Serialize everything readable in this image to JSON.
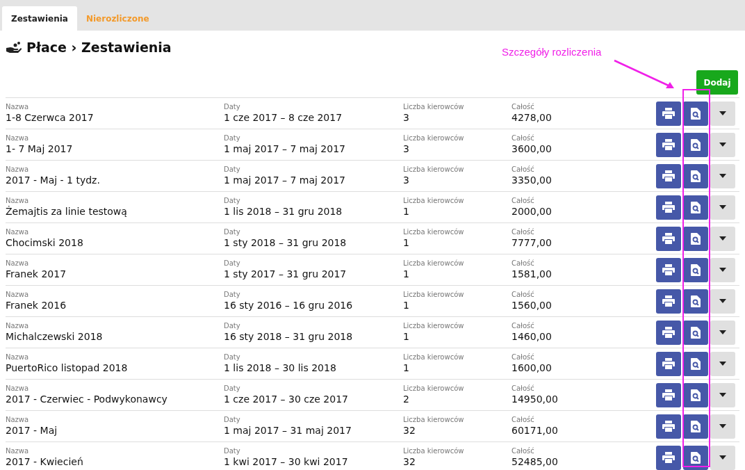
{
  "tabs": [
    {
      "label": "Zestawienia",
      "selected": true
    },
    {
      "label": "Nierozliczone",
      "selected": false
    }
  ],
  "breadcrumb": "Płace › Zestawienia",
  "annotation": "Szczegóły rozliczenia",
  "add_button": "Dodaj",
  "rows": [
    {
      "cells": [
        {
          "label": "Nazwa",
          "value": "1-8 Czerwca 2017"
        },
        {
          "label": "Daty",
          "value": "1 cze 2017 – 8 cze 2017"
        },
        {
          "label": "Liczba kierowców",
          "value": "3"
        },
        {
          "label": "Całość",
          "value": "4278,00"
        }
      ]
    },
    {
      "cells": [
        {
          "label": "Nazwa",
          "value": "1- 7 Maj 2017"
        },
        {
          "label": "Daty",
          "value": "1 maj 2017 – 7 maj 2017"
        },
        {
          "label": "Liczba kierowców",
          "value": "3"
        },
        {
          "label": "Całość",
          "value": "3600,00"
        }
      ]
    },
    {
      "cells": [
        {
          "label": "Nazwa",
          "value": "2017 - Maj - 1 tydz."
        },
        {
          "label": "Daty",
          "value": "1 maj 2017 – 7 maj 2017"
        },
        {
          "label": "Liczba kierowców",
          "value": "3"
        },
        {
          "label": "Całość",
          "value": "3350,00"
        }
      ]
    },
    {
      "cells": [
        {
          "label": "Nazwa",
          "value": "Żemajtis za linie testową"
        },
        {
          "label": "Daty",
          "value": "1 lis 2018 – 31 gru 2018"
        },
        {
          "label": "Liczba kierowców",
          "value": "1"
        },
        {
          "label": "Całość",
          "value": "2000,00"
        }
      ]
    },
    {
      "cells": [
        {
          "label": "Nazwa",
          "value": "Chocimski 2018"
        },
        {
          "label": "Daty",
          "value": "1 sty 2018 – 31 gru 2018"
        },
        {
          "label": "Liczba kierowców",
          "value": "1"
        },
        {
          "label": "Całość",
          "value": "7777,00"
        }
      ]
    },
    {
      "cells": [
        {
          "label": "Nazwa",
          "value": "Franek 2017"
        },
        {
          "label": "Daty",
          "value": "1 sty 2017 – 31 gru 2017"
        },
        {
          "label": "Liczba kierowców",
          "value": "1"
        },
        {
          "label": "Całość",
          "value": "1581,00"
        }
      ]
    },
    {
      "cells": [
        {
          "label": "Nazwa",
          "value": "Franek 2016"
        },
        {
          "label": "Daty",
          "value": "16 sty 2016 – 16 gru 2016"
        },
        {
          "label": "Liczba kierowców",
          "value": "1"
        },
        {
          "label": "Całość",
          "value": "1560,00"
        }
      ]
    },
    {
      "cells": [
        {
          "label": "Nazwa",
          "value": "Michalczewski 2018"
        },
        {
          "label": "Daty",
          "value": "16 sty 2018 – 31 gru 2018"
        },
        {
          "label": "Liczba kierowców",
          "value": "1"
        },
        {
          "label": "Całość",
          "value": "1460,00"
        }
      ]
    },
    {
      "cells": [
        {
          "label": "Nazwa",
          "value": "PuertoRico listopad 2018"
        },
        {
          "label": "Daty",
          "value": "1 lis 2018 – 30 lis 2018"
        },
        {
          "label": "Liczba kierowców",
          "value": "1"
        },
        {
          "label": "Całość",
          "value": "1600,00"
        }
      ]
    },
    {
      "cells": [
        {
          "label": "Nazwa",
          "value": "2017 - Czerwiec - Podwykonawcy"
        },
        {
          "label": "Daty",
          "value": "1 cze 2017 – 30 cze 2017"
        },
        {
          "label": "Liczba kierowców",
          "value": "2"
        },
        {
          "label": "Całość",
          "value": "14950,00"
        }
      ]
    },
    {
      "cells": [
        {
          "label": "Nazwa",
          "value": "2017 - Maj"
        },
        {
          "label": "Daty",
          "value": "1 maj 2017 – 31 maj 2017"
        },
        {
          "label": "Liczba kierowców",
          "value": "32"
        },
        {
          "label": "Całość",
          "value": "60171,00"
        }
      ]
    },
    {
      "cells": [
        {
          "label": "Nazwa",
          "value": "2017 - Kwiecień"
        },
        {
          "label": "Daty",
          "value": "1 kwi 2017 – 30 kwi 2017"
        },
        {
          "label": "Liczba kierowców",
          "value": "32"
        },
        {
          "label": "Całość",
          "value": "52485,00"
        }
      ]
    }
  ]
}
